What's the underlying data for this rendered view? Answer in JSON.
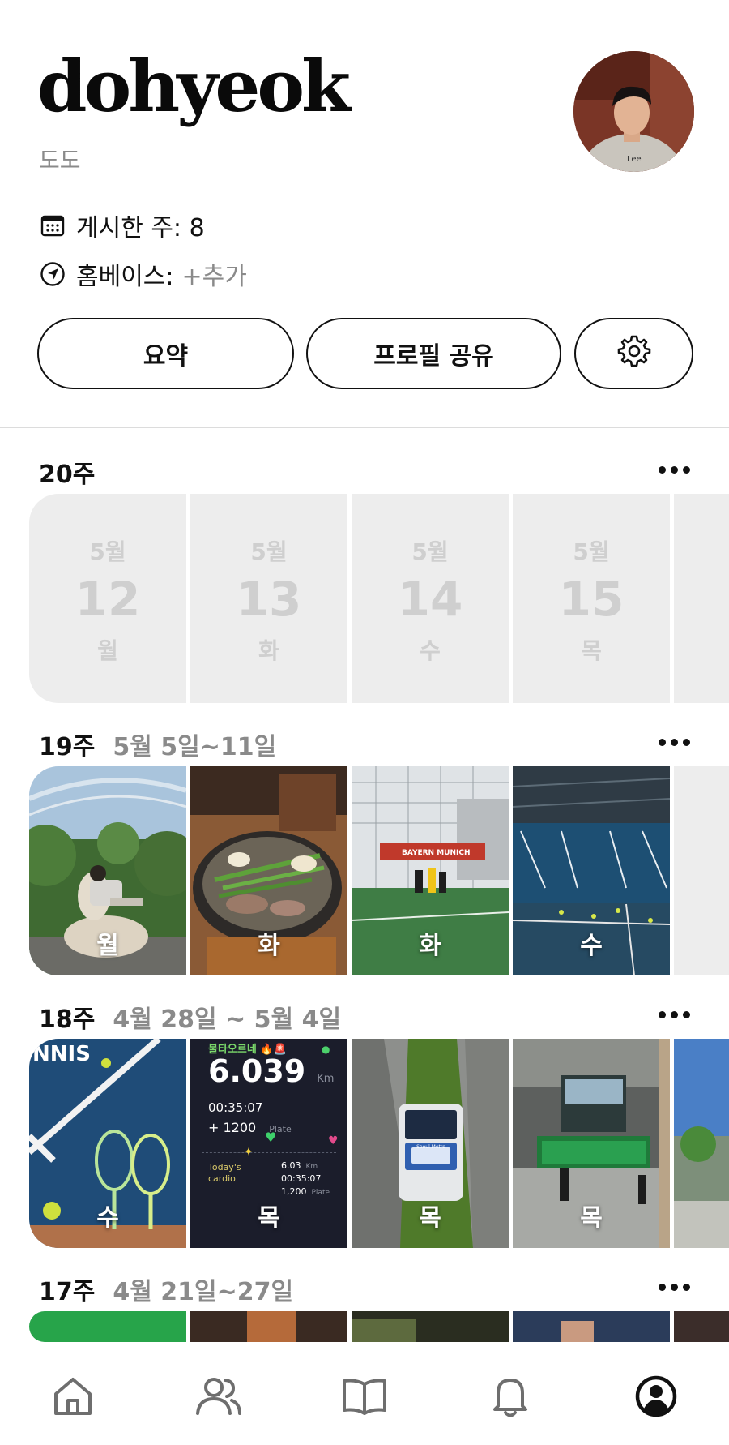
{
  "profile": {
    "username": "dohyeok",
    "nickname": "도도",
    "posted_weeks_label": "게시한 주: 8",
    "homebase_label": "홈베이스:",
    "homebase_add": "+추가"
  },
  "actions": {
    "summary": "요약",
    "share_profile": "프로필 공유",
    "settings_icon": "gear-icon"
  },
  "weeks": [
    {
      "label": "20주",
      "range": "",
      "days": [
        {
          "month": "5월",
          "date": "12",
          "weekday": "월"
        },
        {
          "month": "5월",
          "date": "13",
          "weekday": "화"
        },
        {
          "month": "5월",
          "date": "14",
          "weekday": "수"
        },
        {
          "month": "5월",
          "date": "15",
          "weekday": "목"
        }
      ]
    },
    {
      "label": "19주",
      "range": "5월 5일~11일",
      "photos": [
        {
          "day": "월",
          "scene": "rooftop-garden"
        },
        {
          "day": "화",
          "scene": "hotpot-meal"
        },
        {
          "day": "화",
          "scene": "football-field"
        },
        {
          "day": "수",
          "scene": "tennis-court-indoor"
        }
      ]
    },
    {
      "label": "18주",
      "range": "4월 28일 ~ 5월 4일",
      "photos": [
        {
          "day": "수",
          "scene": "tennis-rackets"
        },
        {
          "day": "목",
          "scene": "running-app"
        },
        {
          "day": "목",
          "scene": "subway-gate"
        },
        {
          "day": "목",
          "scene": "station-hall"
        }
      ],
      "app_screen": {
        "header": "불타오르네 🔥🚨",
        "distance": "6.039",
        "distance_unit": "Km",
        "time": "00:35:07",
        "bonus": "+ 1200",
        "bonus_unit": "Plate",
        "card_title": "Today's cardio",
        "card_distance": "6.03",
        "card_distance_unit": "Km",
        "card_time": "00:35:07",
        "card_plate": "1,200",
        "card_plate_unit": "Plate"
      },
      "tennis_sign": "NNIS",
      "gate_screen": "Seoul Metro"
    },
    {
      "label": "17주",
      "range": "4월 21일~27일"
    }
  ],
  "tabbar": [
    "home-icon",
    "friends-icon",
    "book-icon",
    "bell-icon",
    "profile-icon"
  ]
}
